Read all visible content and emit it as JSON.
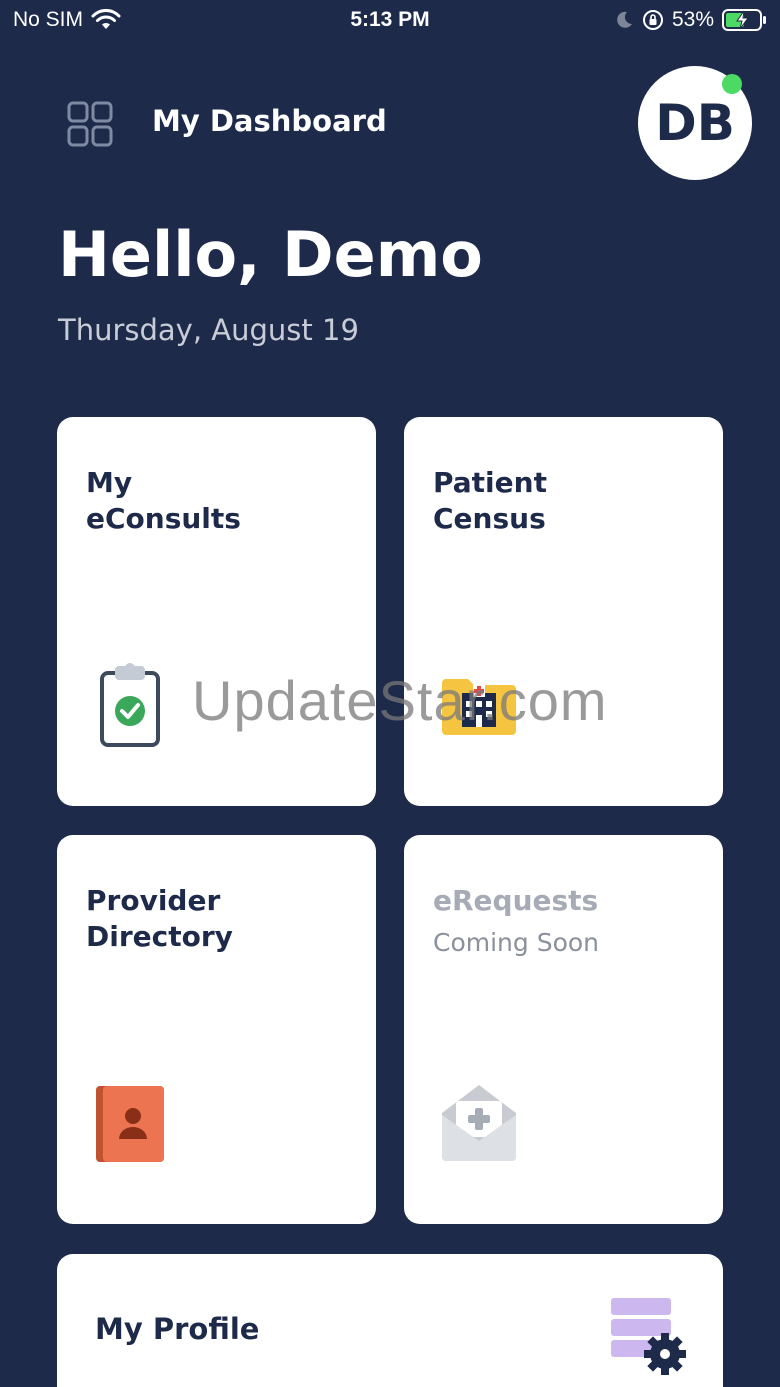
{
  "status_bar": {
    "carrier": "No SIM",
    "time": "5:13 PM",
    "battery": "53%"
  },
  "header": {
    "title": "My Dashboard",
    "avatar_initials": "DB",
    "menu_icon": "grid-icon",
    "online_status_color": "#4cd964"
  },
  "greeting": "Hello, Demo",
  "date": "Thursday, August 19",
  "tiles": {
    "econsults": {
      "line1": "My",
      "line2": "eConsults",
      "icon": "clipboard-check-icon"
    },
    "census": {
      "line1": "Patient",
      "line2": "Census",
      "icon": "hospital-folder-icon"
    },
    "directory": {
      "line1": "Provider",
      "line2": "Directory",
      "icon": "contact-book-icon"
    },
    "erequests": {
      "title": "eRequests",
      "subtitle": "Coming Soon",
      "icon": "medical-envelope-icon"
    }
  },
  "profile": {
    "title": "My Profile",
    "icon": "profile-settings-icon"
  },
  "watermark": "UpdateStar.com",
  "colors": {
    "background": "#1e2a4a",
    "card": "#ffffff",
    "text_dark": "#1e2a4a",
    "disabled_text": "#a6abb6"
  }
}
